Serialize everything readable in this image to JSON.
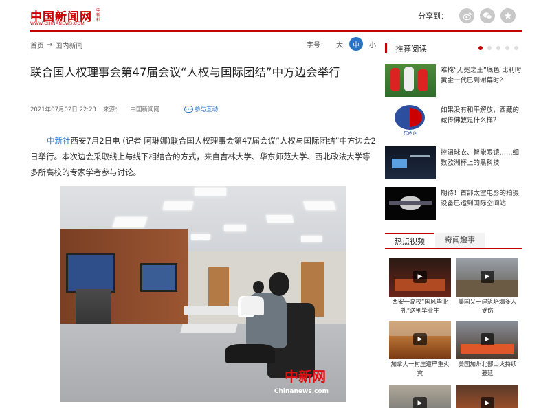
{
  "logo": {
    "main": "中国新闻网",
    "tag": "中新社",
    "sub": "WWW.CHINANEWS.COM"
  },
  "share": {
    "label": "分享到：",
    "icons": [
      "weibo-icon",
      "wechat-icon",
      "star-icon"
    ]
  },
  "breadcrumb": {
    "home": "首页",
    "arrow": "→",
    "section": "国内新闻"
  },
  "font_size": {
    "label": "字号：",
    "large": "大",
    "medium": "中",
    "small": "小"
  },
  "article": {
    "title": "联合国人权理事会第47届会议“人权与国际团结”中方边会举行",
    "datetime": "2021年07月02日 22:23",
    "source_label": "来源：",
    "source": "中国新闻网",
    "comment_label": "参与互动",
    "agency": "中新社",
    "body": "西安7月2日电 (记者 阿琳娜)联合国人权理事会第47届会议“人权与国际团结”中方边会2日举行。本次边会采取线上与线下相结合的方式，来自吉林大学、华东师范大学、西北政法大学等多所高校的专家学者参与讨论。",
    "photo_watermark_cn": "中新网",
    "photo_watermark_en": "Chinanews.com"
  },
  "sidebar": {
    "recommend_title": "推荐阅读",
    "recommend": [
      {
        "text": "难掩“无冕之王”底色 比利时黄金一代已到谢幕时？"
      },
      {
        "text": "如果没有和平解放，西藏的藏传佛教是什么样？",
        "badge": "东西问"
      },
      {
        "text": "控温球衣、智能眼镜……细数欧洲杯上的黑科技"
      },
      {
        "text": "期待！首部太空电影的拍摄设备已运到国际空间站"
      }
    ],
    "tabs": [
      "热点视频",
      "奇闻趣事"
    ],
    "videos": [
      {
        "caption": "西安一高校“国风毕业礼”送别毕业生"
      },
      {
        "caption": "美国又一建筑坍塌多人受伤"
      },
      {
        "caption": "加拿大一村庄遭严重火灾"
      },
      {
        "caption": "美国加州北部山火持续蔓延"
      }
    ]
  }
}
